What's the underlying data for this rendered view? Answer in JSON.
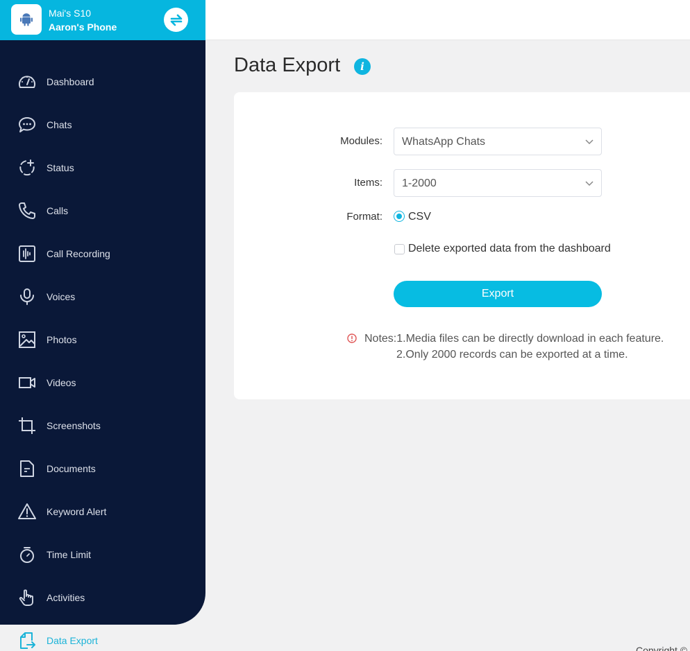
{
  "device": {
    "name": "Mai's S10",
    "owner": "Aaron's Phone",
    "logo_icon": "android-icon",
    "switch_icon": "switch-device-icon"
  },
  "sidebar": {
    "items": [
      {
        "label": "Dashboard",
        "icon": "dashboard-gauge-icon"
      },
      {
        "label": "Chats",
        "icon": "chat-bubble-icon"
      },
      {
        "label": "Status",
        "icon": "status-circle-plus-icon"
      },
      {
        "label": "Calls",
        "icon": "phone-icon"
      },
      {
        "label": "Call Recording",
        "icon": "audio-wave-icon"
      },
      {
        "label": "Voices",
        "icon": "microphone-icon"
      },
      {
        "label": "Photos",
        "icon": "image-icon"
      },
      {
        "label": "Videos",
        "icon": "video-camera-icon"
      },
      {
        "label": "Screenshots",
        "icon": "crop-icon"
      },
      {
        "label": "Documents",
        "icon": "document-icon"
      },
      {
        "label": "Keyword Alert",
        "icon": "warning-triangle-icon"
      },
      {
        "label": "Time Limit",
        "icon": "stopwatch-icon"
      },
      {
        "label": "Activities",
        "icon": "hand-pointer-icon"
      },
      {
        "label": "Data Export",
        "icon": "export-file-icon",
        "active": true
      }
    ]
  },
  "main": {
    "title": "Data Export",
    "form": {
      "modules_label": "Modules:",
      "modules_value": "WhatsApp Chats",
      "items_label": "Items:",
      "items_value": "1-2000",
      "format_label": "Format:",
      "format_option": "CSV",
      "format_selected": true,
      "delete_label": "Delete exported data from the dashboard",
      "delete_checked": false,
      "export_label": "Export"
    },
    "notes": {
      "line1": "Notes:1.Media files can be directly download in each feature.",
      "line2": "2.Only 2000 records can be exported at a time."
    }
  },
  "footer": {
    "copyright": "Copyright ©"
  },
  "colors": {
    "accent": "#07bce2",
    "sidebar_bg": "#0a1838",
    "warning": "#e05757"
  }
}
